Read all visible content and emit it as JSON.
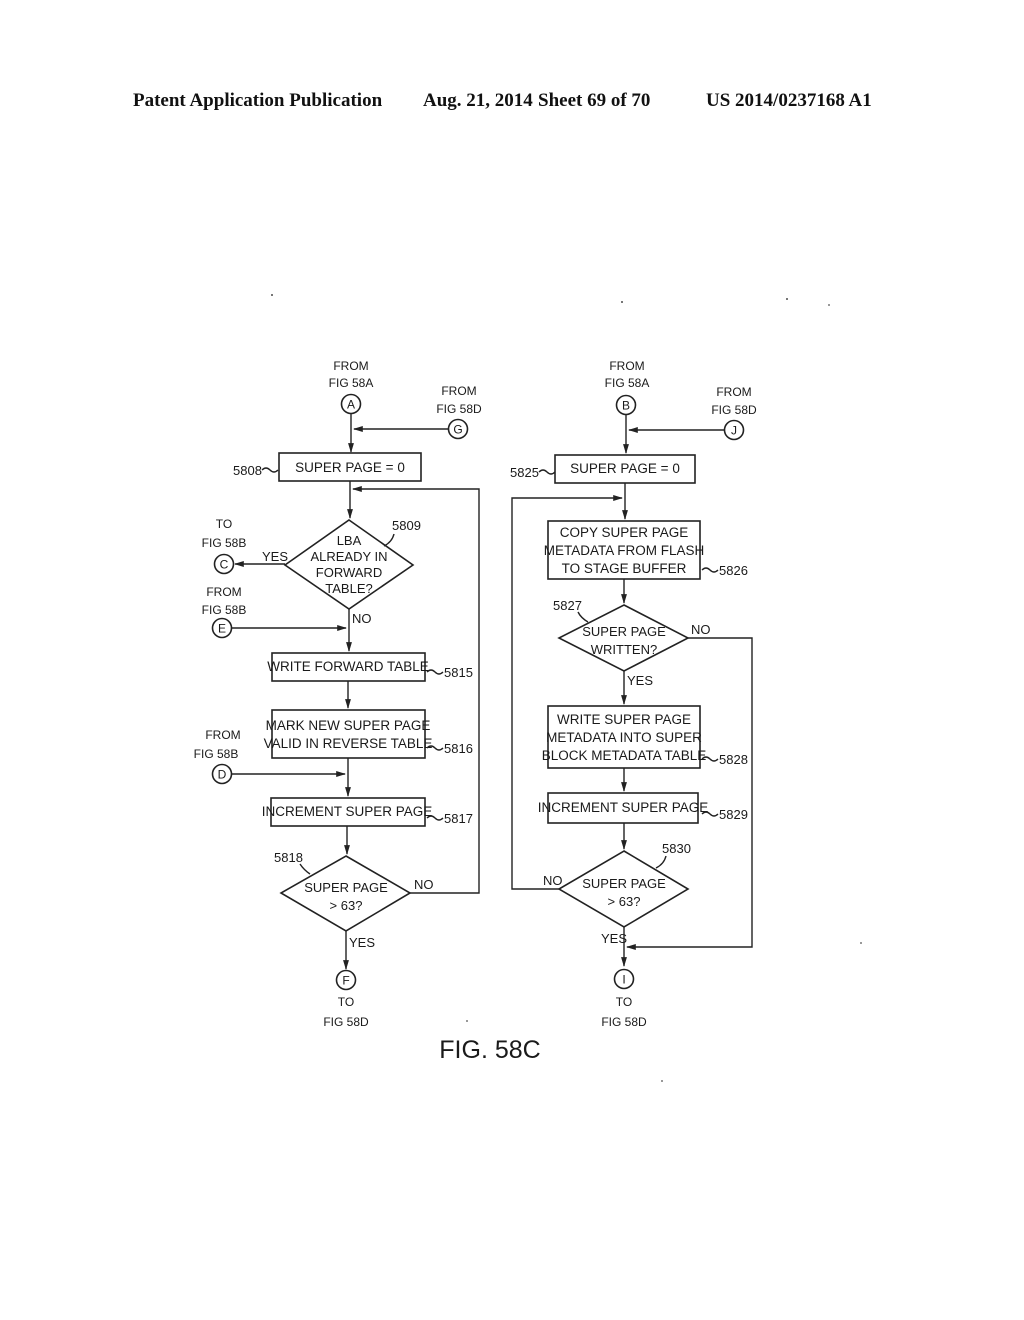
{
  "header": {
    "publication": "Patent Application Publication",
    "date": "Aug. 21, 2014",
    "sheet": "Sheet 69 of 70",
    "number": "US 2014/0237168 A1"
  },
  "figure_label": "FIG. 58C",
  "left_flow": {
    "connectors": {
      "A": {
        "letter": "A",
        "line1": "FROM",
        "line2": "FIG 58A"
      },
      "G": {
        "letter": "G",
        "line1": "FROM",
        "line2": "FIG 58D"
      },
      "C": {
        "letter": "C",
        "line1": "TO",
        "line2": "FIG 58B"
      },
      "E": {
        "letter": "E",
        "line1": "FROM",
        "line2": "FIG 58B"
      },
      "D": {
        "letter": "D",
        "line1": "FROM",
        "line2": "FIG 58B"
      },
      "F": {
        "letter": "F",
        "line1": "TO",
        "line2": "FIG 58D"
      }
    },
    "steps": {
      "s5808": {
        "ref": "5808",
        "lines": [
          "SUPER PAGE = 0"
        ]
      },
      "s5809": {
        "ref": "5809",
        "lines": [
          "LBA",
          "ALREADY IN",
          "FORWARD",
          "TABLE?"
        ],
        "yes": "YES",
        "no": "NO"
      },
      "s5815": {
        "ref": "5815",
        "lines": [
          "WRITE FORWARD TABLE"
        ]
      },
      "s5816": {
        "ref": "5816",
        "lines": [
          "MARK NEW SUPER PAGE",
          "VALID IN REVERSE TABLE"
        ]
      },
      "s5817": {
        "ref": "5817",
        "lines": [
          "INCREMENT SUPER PAGE"
        ]
      },
      "s5818": {
        "ref": "5818",
        "lines": [
          "SUPER PAGE",
          "> 63?"
        ],
        "yes": "YES",
        "no": "NO"
      }
    }
  },
  "right_flow": {
    "connectors": {
      "B": {
        "letter": "B",
        "line1": "FROM",
        "line2": "FIG 58A"
      },
      "J": {
        "letter": "J",
        "line1": "FROM",
        "line2": "FIG 58D"
      },
      "I": {
        "letter": "I",
        "line1": "TO",
        "line2": "FIG 58D"
      }
    },
    "steps": {
      "s5825": {
        "ref": "5825",
        "lines": [
          "SUPER PAGE = 0"
        ]
      },
      "s5826": {
        "ref": "5826",
        "lines": [
          "COPY SUPER PAGE",
          "METADATA FROM FLASH",
          "TO STAGE BUFFER"
        ]
      },
      "s5827": {
        "ref": "5827",
        "lines": [
          "SUPER PAGE",
          "WRITTEN?"
        ],
        "yes": "YES",
        "no": "NO"
      },
      "s5828": {
        "ref": "5828",
        "lines": [
          "WRITE SUPER PAGE",
          "METADATA INTO SUPER",
          "BLOCK METADATA TABLE"
        ]
      },
      "s5829": {
        "ref": "5829",
        "lines": [
          "INCREMENT SUPER PAGE"
        ]
      },
      "s5830": {
        "ref": "5830",
        "lines": [
          "SUPER PAGE",
          "> 63?"
        ],
        "yes": "YES",
        "no": "NO"
      }
    }
  }
}
